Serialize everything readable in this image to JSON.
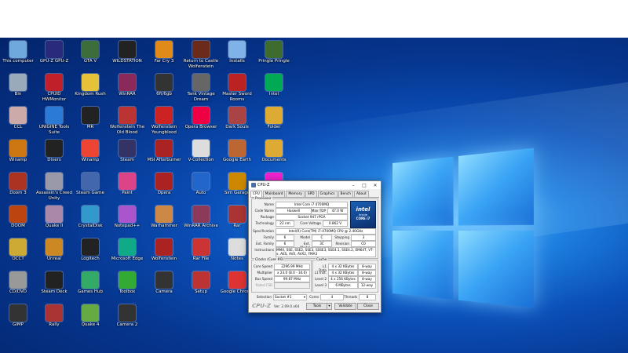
{
  "desktop": {
    "icons": [
      {
        "label": "This computer",
        "color": "#6fa8dc",
        "icon": "computer-icon"
      },
      {
        "label": "GPU-Z GPU-Z",
        "color": "#2a2a7a",
        "icon": "gpuz-icon"
      },
      {
        "label": "GTA V",
        "color": "#3c6e3c",
        "icon": "gta-icon"
      },
      {
        "label": "WILDSTATION",
        "color": "#222",
        "icon": "wild-icon"
      },
      {
        "label": "Far Cry 3",
        "color": "#e08a1a",
        "icon": "farcry-icon"
      },
      {
        "label": "Return to Castle Wolfenstein Single...",
        "color": "#6b2a1a",
        "icon": "wolf-icon"
      },
      {
        "label": "Installs",
        "color": "#7fb2e6",
        "icon": "file-icon"
      },
      {
        "label": "Pringle Pringle",
        "color": "#3e6b2e",
        "icon": "app-icon"
      },
      {
        "label": "Bin",
        "color": "#9ab",
        "icon": "recycle-bin-icon"
      },
      {
        "label": "CPUID HWMonitor",
        "color": "#c0202a",
        "icon": "hwmon-icon"
      },
      {
        "label": "Kingdom Rush",
        "color": "#e6c13a",
        "icon": "kr-icon"
      },
      {
        "label": "WinRAR",
        "color": "#8b2a5a",
        "icon": "winrar-icon"
      },
      {
        "label": "6ft/6gb",
        "color": "#333",
        "icon": "app-icon"
      },
      {
        "label": "Tank Vintage Dream Machines",
        "color": "#666",
        "icon": "tank-icon"
      },
      {
        "label": "Master Sword Rooms",
        "color": "#b22",
        "icon": "ms-icon"
      },
      {
        "label": "Intel",
        "color": "#0a5",
        "icon": "app-icon"
      },
      {
        "label": "CCL",
        "color": "#caa",
        "icon": "folder-icon"
      },
      {
        "label": "UNIGINE Tools Suite",
        "color": "#2a7ad6",
        "icon": "unigine-icon"
      },
      {
        "label": "MR",
        "color": "#222",
        "icon": "mr-icon"
      },
      {
        "label": "Wolfenstein The Old Blood",
        "color": "#b33",
        "icon": "wolf2-icon"
      },
      {
        "label": "Wolfenstein Youngblood",
        "color": "#c22",
        "icon": "wolf3-icon"
      },
      {
        "label": "Opera Browser",
        "color": "#e04",
        "icon": "opera-icon"
      },
      {
        "label": "Dark Souls",
        "color": "#a44",
        "icon": "ds-icon"
      },
      {
        "label": "Folder",
        "color": "#da3",
        "icon": "folder-icon"
      },
      {
        "label": "Winamp",
        "color": "#c71",
        "icon": "winamp-icon"
      },
      {
        "label": "Divers",
        "color": "#222",
        "icon": "app-icon"
      },
      {
        "label": "Winamp",
        "color": "#e43",
        "icon": "winamp2-icon"
      },
      {
        "label": "Steam",
        "color": "#336",
        "icon": "steam-icon"
      },
      {
        "label": "MSI Afterburner",
        "color": "#a22",
        "icon": "msi-icon"
      },
      {
        "label": "V-Collection",
        "color": "#ddd",
        "icon": "file-icon"
      },
      {
        "label": "Google Earth",
        "color": "#b63",
        "icon": "earth-icon"
      },
      {
        "label": "Documents",
        "color": "#da3",
        "icon": "folder-icon"
      },
      {
        "label": "Doom 3",
        "color": "#a32",
        "icon": "doom3-icon"
      },
      {
        "label": "Assassin's Creed Unity",
        "color": "#99a",
        "icon": "ac-icon"
      },
      {
        "label": "Steam Game",
        "color": "#46a",
        "icon": "game-icon"
      },
      {
        "label": "Paint",
        "color": "#d48",
        "icon": "paint-icon"
      },
      {
        "label": "Opera",
        "color": "#a22",
        "icon": "opera2-icon"
      },
      {
        "label": "Auto",
        "color": "#26c",
        "icon": "auto-icon"
      },
      {
        "label": "Sim Garage",
        "color": "#c80",
        "icon": "mo-icon"
      },
      {
        "label": "Microsoft Teams",
        "color": "#e2c",
        "icon": "teams-icon"
      },
      {
        "label": "DOOM",
        "color": "#b41",
        "icon": "doom-icon"
      },
      {
        "label": "Quake II",
        "color": "#a8a",
        "icon": "quake-icon"
      },
      {
        "label": "CrystalDisk",
        "color": "#39c",
        "icon": "disk-icon"
      },
      {
        "label": "Notepad++",
        "color": "#a5c",
        "icon": "npp-icon"
      },
      {
        "label": "Warhammer",
        "color": "#c84",
        "icon": "wh-icon"
      },
      {
        "label": "WinRAR Archive",
        "color": "#8b3a5a",
        "icon": "rar-icon"
      },
      {
        "label": "Rar",
        "color": "#a33",
        "icon": "rar2-icon"
      },
      {
        "label": "Paint Ultimate",
        "color": "#39c",
        "icon": "paint2-icon"
      },
      {
        "label": "OCCT",
        "color": "#ca3",
        "icon": "occt-icon"
      },
      {
        "label": "Unreal",
        "color": "#c82",
        "icon": "unreal-icon"
      },
      {
        "label": "Logitech",
        "color": "#222",
        "icon": "logi-icon"
      },
      {
        "label": "Microsoft Edge",
        "color": "#1a8",
        "icon": "edge-icon"
      },
      {
        "label": "Wolfenstein",
        "color": "#a22",
        "icon": "wolf4-icon"
      },
      {
        "label": "Rar File",
        "color": "#c33",
        "icon": "rar3-icon"
      },
      {
        "label": "Notes",
        "color": "#ddd",
        "icon": "file-icon"
      },
      {
        "label": "Clock",
        "color": "#aaa",
        "icon": "clock-icon"
      },
      {
        "label": "CD/DVD",
        "color": "#999",
        "icon": "cd-icon"
      },
      {
        "label": "Steam Deck",
        "color": "#222",
        "icon": "deck-icon"
      },
      {
        "label": "Games Hub",
        "color": "#3a6",
        "icon": "hub-icon"
      },
      {
        "label": "Toolbox",
        "color": "#3a3",
        "icon": "tool-icon"
      },
      {
        "label": "Camera",
        "color": "#333",
        "icon": "cam-icon"
      },
      {
        "label": "Setup",
        "color": "#b33",
        "icon": "setup-icon"
      },
      {
        "label": "Google Chrome",
        "color": "#d33",
        "icon": "chrome-icon"
      },
      {
        "label": "VLC media player",
        "color": "#f80",
        "icon": "vlc-icon"
      },
      {
        "label": "GIMP",
        "color": "#333",
        "icon": "gimp-icon"
      },
      {
        "label": "Rally",
        "color": "#a33",
        "icon": "rally-icon"
      },
      {
        "label": "Quake 4",
        "color": "#6a4",
        "icon": "quake4-icon"
      },
      {
        "label": "Camera 2",
        "color": "#333",
        "icon": "cam2-icon"
      }
    ]
  },
  "cpuz": {
    "title": "CPU-Z",
    "tabs": [
      "CPU",
      "Mainboard",
      "Memory",
      "SPD",
      "Graphics",
      "Bench",
      "About"
    ],
    "processor_group": "Processor",
    "name_label": "Name",
    "name_value": "Intel Core i7 4700MQ",
    "codename_label": "Code Name",
    "codename_value": "Haswell",
    "maxtdp_label": "Max TDP",
    "maxtdp_value": "47.0 W",
    "package_label": "Package",
    "package_value": "Socket 947 rPGA",
    "technology_label": "Technology",
    "technology_value": "22 nm",
    "voltage_label": "Core Voltage",
    "voltage_value": "0.862 V",
    "spec_label": "Specification",
    "spec_value": "Intel(R) Core(TM) i7-4700MQ CPU @ 2.40GHz",
    "family_label": "Family",
    "family_value": "6",
    "model_label": "Model",
    "model_value": "C",
    "stepping_label": "Stepping",
    "stepping_value": "3",
    "extfamily_label": "Ext. Family",
    "extfamily_value": "6",
    "extmodel_label": "Ext. Model",
    "extmodel_value": "3C",
    "revision_label": "Revision",
    "revision_value": "C0",
    "instructions_label": "Instructions",
    "instructions_value": "MMX, SSE, SSE2, SSE3, SSSE3, SSE4.1, SSE4.2, EM64T, VT-x, AES, AVX, AVX2, FMA3",
    "clocks_group": "Clocks (Core #0)",
    "corespeed_label": "Core Speed",
    "corespeed_value": "2296.99 MHz",
    "multiplier_label": "Multiplier",
    "multiplier_value": "x 23.0 (8.0 - 34.0)",
    "busspeed_label": "Bus Speed",
    "busspeed_value": "99.87 MHz",
    "ratedfsb_label": "Rated FSB",
    "cache_group": "Cache",
    "l1d_label": "L1 Data",
    "l1d_value": "4 x 32 KBytes",
    "l1d_way": "8-way",
    "l1i_label": "L1 Inst.",
    "l1i_value": "4 x 32 KBytes",
    "l1i_way": "8-way",
    "l2_label": "Level 2",
    "l2_value": "4 x 256 KBytes",
    "l2_way": "8-way",
    "l3_label": "Level 3",
    "l3_value": "6 MBytes",
    "l3_way": "12-way",
    "selection_label": "Selection",
    "selection_value": "Socket #1",
    "cores_label": "Cores",
    "cores_value": "4",
    "threads_label": "Threads",
    "threads_value": "8",
    "logo_text": "CPU-Z",
    "version": "Ver. 2.09.0.x64",
    "tools_label": "Tools",
    "validate_label": "Validate",
    "close_label": "Close",
    "intel_badge": {
      "brand": "intel",
      "line1": "inside",
      "line2": "CORE i7"
    }
  }
}
